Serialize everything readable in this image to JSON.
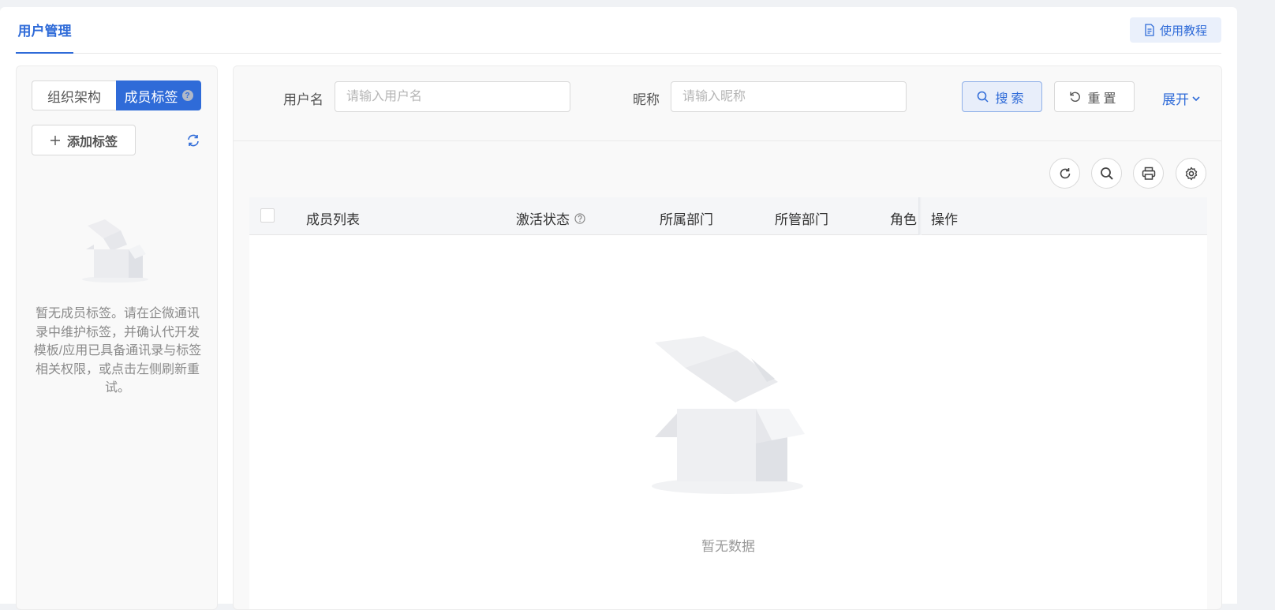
{
  "header": {
    "tab_label": "用户管理",
    "help_label": "使用教程"
  },
  "left": {
    "seg_org": "组织架构",
    "seg_tags": "成员标签",
    "seg_tags_badge": "?",
    "add_tag_label": "添加标签",
    "empty_text": "暂无成员标签。请在企微通讯录中维护标签，并确认代开发模板/应用已具备通讯录与标签相关权限，或点击左侧刷新重试。"
  },
  "filter": {
    "username_label": "用户名",
    "username_placeholder": "请输入用户名",
    "nickname_label": "昵称",
    "nickname_placeholder": "请输入昵称",
    "search_label": "搜索",
    "reset_label": "重置",
    "expand_label": "展开"
  },
  "table": {
    "columns": [
      "成员列表",
      "激活状态",
      "所属部门",
      "所管部门",
      "角色",
      "操作"
    ],
    "empty_text": "暂无数据"
  },
  "colors": {
    "accent": "#2f6bd8"
  }
}
